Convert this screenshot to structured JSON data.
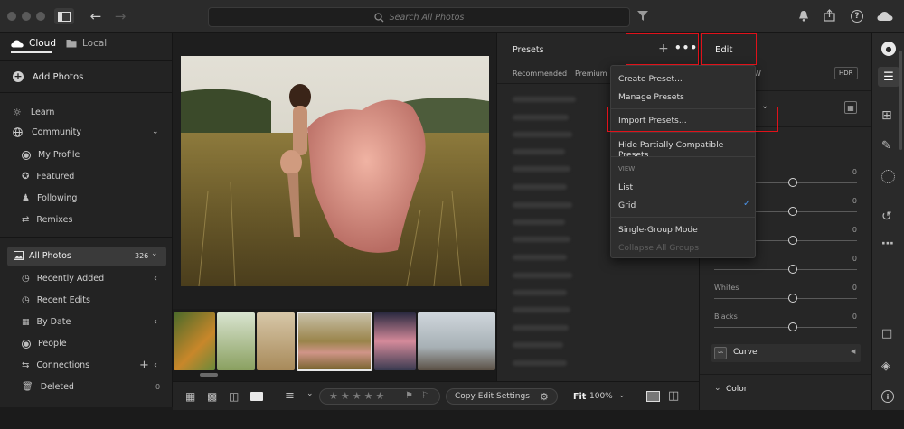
{
  "search": {
    "placeholder": "Search All Photos"
  },
  "left": {
    "tabs": {
      "cloud": "Cloud",
      "local": "Local"
    },
    "add_photos": "Add Photos",
    "learn": "Learn",
    "community": "Community",
    "community_items": [
      "My Profile",
      "Featured",
      "Following",
      "Remixes"
    ],
    "all_photos": "All Photos",
    "all_photos_count": "326",
    "library_items": [
      "Recently Added",
      "Recent Edits",
      "By Date",
      "People",
      "Connections",
      "Deleted"
    ],
    "deleted_count": "0"
  },
  "presets": {
    "title": "Presets",
    "tabs": [
      "Recommended",
      "Premium"
    ]
  },
  "edit": {
    "title": "Edit",
    "badge_w": "W",
    "hdr": "HDR",
    "sliders": [
      {
        "label": "",
        "value": "0",
        "pos": 0.55
      },
      {
        "label": "",
        "value": "0",
        "pos": 0.55
      },
      {
        "label": "",
        "value": "0",
        "pos": 0.55
      },
      {
        "label": "",
        "value": "0",
        "pos": 0.55
      },
      {
        "label": "Whites",
        "value": "0",
        "pos": 0.55
      },
      {
        "label": "Blacks",
        "value": "0",
        "pos": 0.55
      }
    ],
    "curve": "Curve",
    "color": "Color"
  },
  "menu": {
    "create": "Create Preset...",
    "manage": "Manage Presets",
    "import": "Import Presets...",
    "hide": "Hide Partially Compatible Presets",
    "view_header": "VIEW",
    "list": "List",
    "grid": "Grid",
    "single_group": "Single-Group Mode",
    "collapse": "Collapse All Groups"
  },
  "bottombar": {
    "copy_edit": "Copy Edit Settings",
    "fit": "Fit",
    "zoom": "100%"
  },
  "colors": {
    "highlight": "#e0121a",
    "check": "#4a90e2"
  }
}
